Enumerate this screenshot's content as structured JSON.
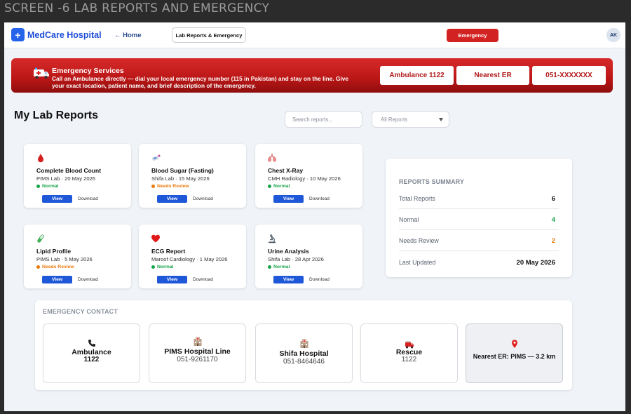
{
  "screen_caption": "SCREEN -6 LAB REPORTS AND EMERGENCY",
  "colors": {
    "brand": "#1d4ed8",
    "emergency": "#d32222",
    "normal": "#16a34a",
    "review": "#ea7a0c",
    "view_button": "#1f57d9"
  },
  "header": {
    "brand_logo": "+",
    "brand_name": "MedCare Hospital",
    "home_link": "← Home",
    "page_chip": "Lab Reports & Emergency",
    "emergency_button": "Emergency",
    "avatar_initials": "AK"
  },
  "banner": {
    "icon": "ambulance-icon",
    "title": "Emergency Services",
    "text": "Call an Ambulance directly — dial your local emergency number (115 in Pakistan) and stay on the line. Give your exact location, patient name, and brief description of the emergency.",
    "buttons": [
      "Ambulance 1122",
      "Nearest ER",
      "051-XXXXXXX"
    ]
  },
  "lab_reports": {
    "title": "My Lab Reports",
    "search_placeholder": "Search reports...",
    "filter_value": "All Reports",
    "cards": [
      {
        "icon": "blood-drop-icon",
        "title": "Complete Blood Count",
        "meta": "PIMS Lab · 20 May 2026",
        "status": "Normal",
        "view": "View",
        "download": "Download"
      },
      {
        "icon": "glucose-meter-icon",
        "title": "Blood Sugar (Fasting)",
        "meta": "Shifa Lab · 15 May 2026",
        "status": "Needs Review",
        "view": "View",
        "download": "Download"
      },
      {
        "icon": "lungs-icon",
        "title": "Chest X-Ray",
        "meta": "CMH Radiology · 10 May 2026",
        "status": "Normal",
        "view": "View",
        "download": "Download"
      },
      {
        "icon": "test-tube-icon",
        "title": "Lipid Profile",
        "meta": "PIMS Lab · 5 May 2026",
        "status": "Needs Review",
        "view": "View",
        "download": "Download"
      },
      {
        "icon": "heart-icon",
        "title": "ECG Report",
        "meta": "Maroof Cardiology · 1 May 2026",
        "status": "Normal",
        "view": "View",
        "download": "Download"
      },
      {
        "icon": "microscope-icon",
        "title": "Urine Analysis",
        "meta": "Shifa Lab · 28 Apr 2026",
        "status": "Normal",
        "view": "View",
        "download": "Download"
      }
    ]
  },
  "summary": {
    "title": "REPORTS SUMMARY",
    "rows": [
      {
        "label": "Total Reports",
        "value": "6"
      },
      {
        "label": "Normal",
        "value": "4"
      },
      {
        "label": "Needs Review",
        "value": "2"
      },
      {
        "label": "Last Updated",
        "value": "20 May 2026"
      }
    ]
  },
  "emergency_contact": {
    "title": "EMERGENCY CONTACT",
    "cards": [
      {
        "icon": "phone-icon",
        "name": "Ambulance",
        "number": "1122"
      },
      {
        "icon": "hospital-icon",
        "name": "PIMS Hospital Line",
        "number": "051-9261170"
      },
      {
        "icon": "hospital-icon",
        "name": "Shifa Hospital",
        "number": "051-8464646"
      },
      {
        "icon": "fire-truck-icon",
        "name": "Rescue",
        "number": "1122"
      },
      {
        "icon": "location-pin-icon",
        "name": "Nearest ER: PIMS — 3.2 km",
        "number": ""
      }
    ]
  }
}
